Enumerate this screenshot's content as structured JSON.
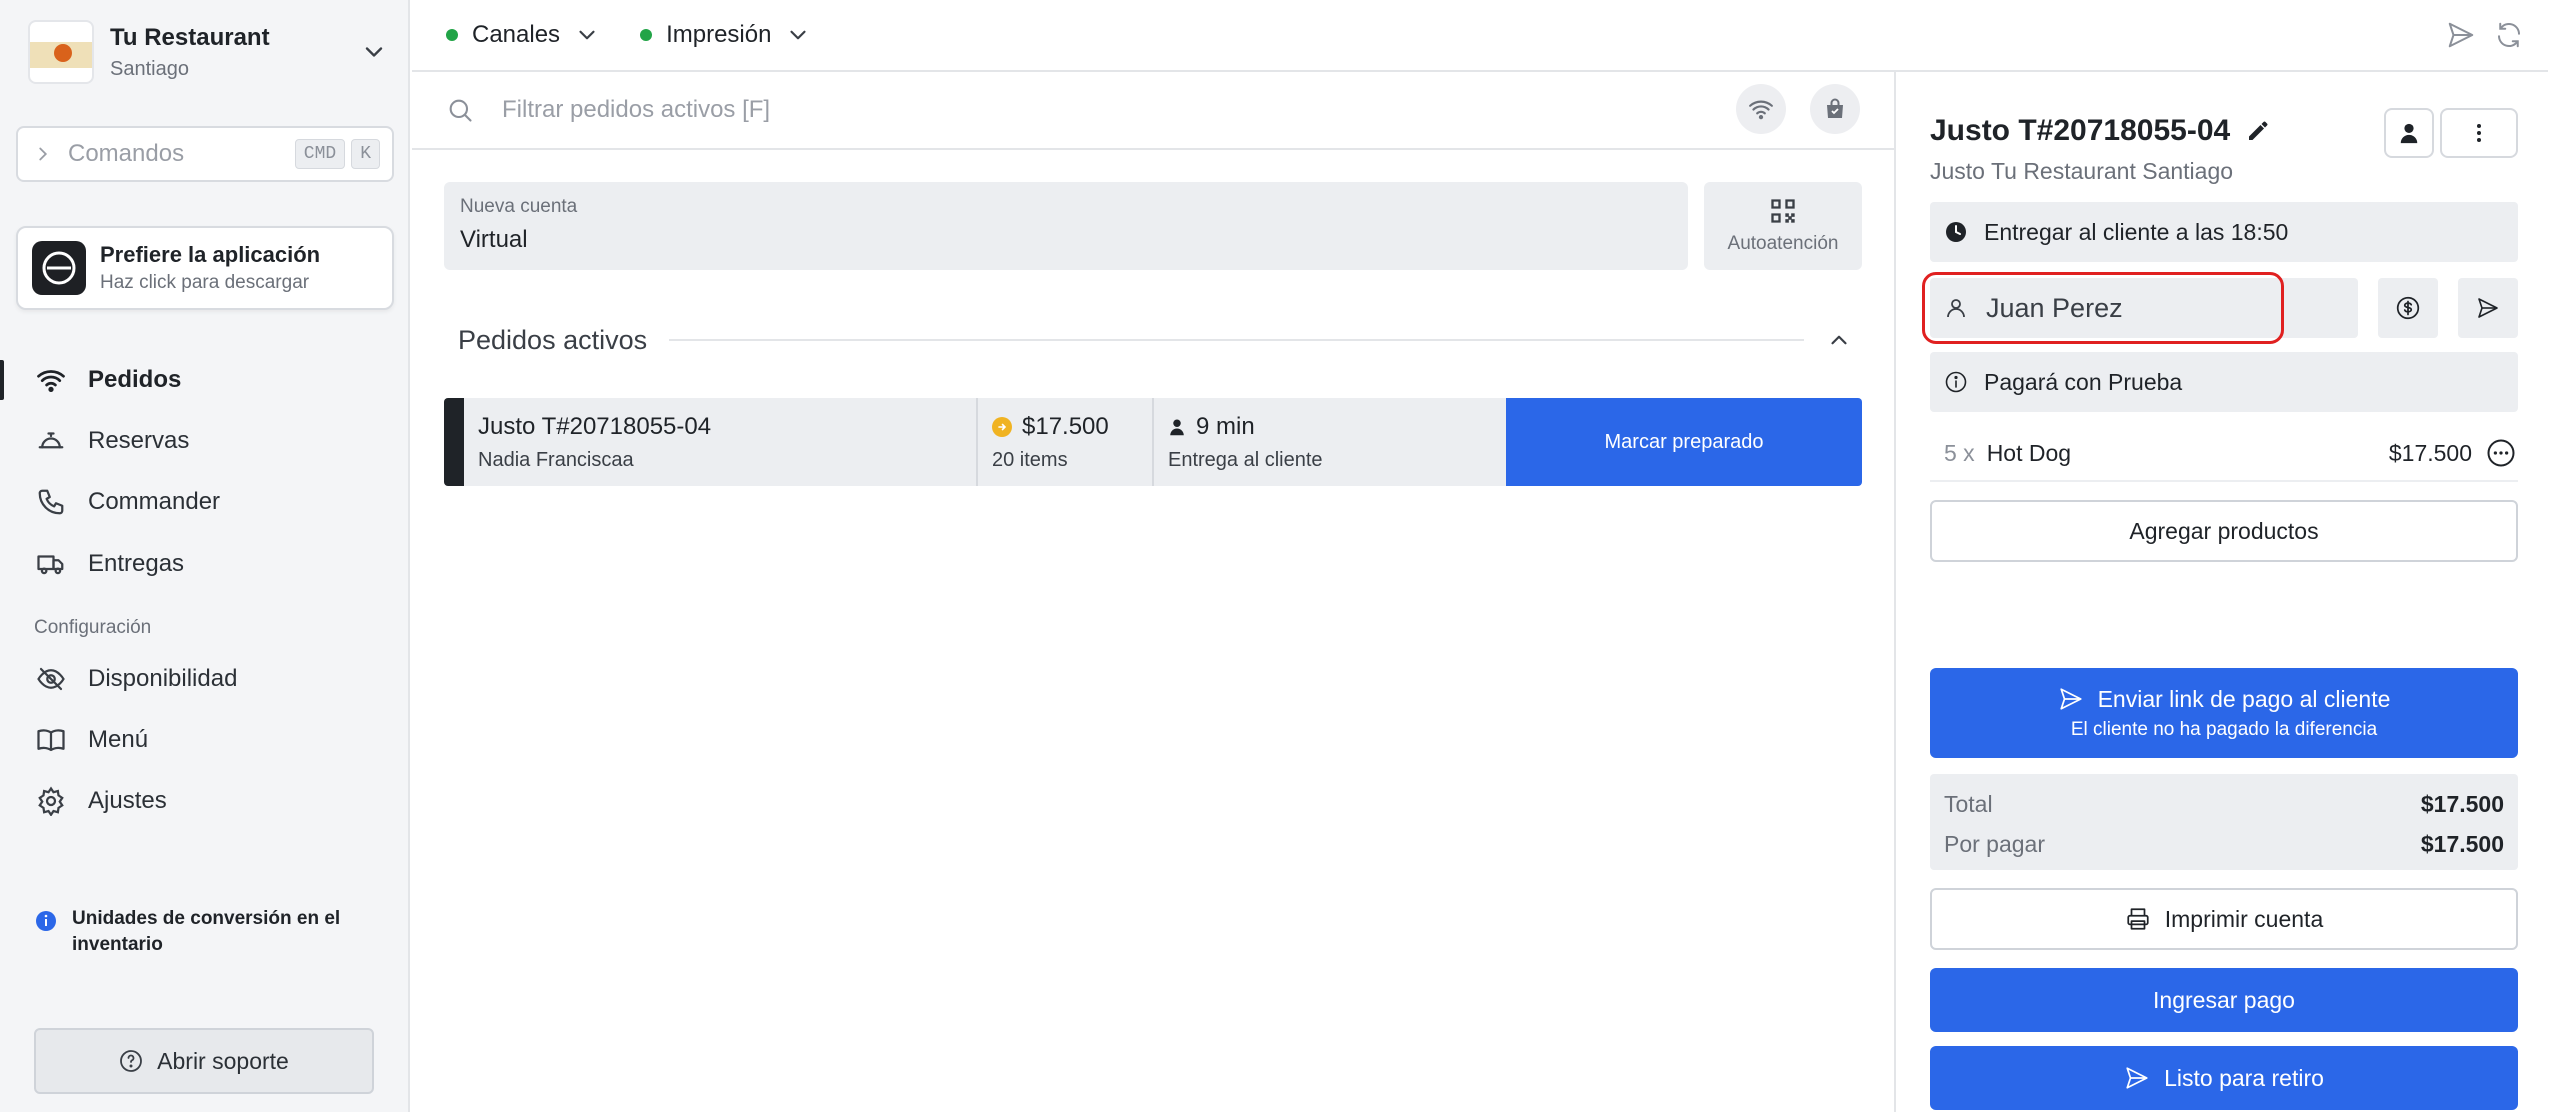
{
  "restaurant": {
    "name": "Tu Restaurant",
    "city": "Santiago"
  },
  "commands": {
    "label": "Comandos",
    "kbd1": "CMD",
    "kbd2": "K"
  },
  "app_promo": {
    "title": "Prefiere la aplicación",
    "subtitle": "Haz click para descargar"
  },
  "nav": {
    "items": [
      {
        "label": "Pedidos",
        "icon": "wifi-icon",
        "active": true
      },
      {
        "label": "Reservas",
        "icon": "bell-icon"
      },
      {
        "label": "Commander",
        "icon": "phone-icon"
      },
      {
        "label": "Entregas",
        "icon": "truck-icon"
      }
    ],
    "section_label": "Configuración",
    "config_items": [
      {
        "label": "Disponibilidad",
        "icon": "eye-off-icon"
      },
      {
        "label": "Menú",
        "icon": "book-icon"
      },
      {
        "label": "Ajustes",
        "icon": "gear-icon"
      }
    ]
  },
  "notice": {
    "text": "Unidades de conversión en el inventario"
  },
  "support": {
    "label": "Abrir soporte"
  },
  "topbar": {
    "channels_label": "Canales",
    "print_label": "Impresión",
    "status_color": "#22a447"
  },
  "filter": {
    "placeholder": "Filtrar pedidos activos [F]"
  },
  "new_account": {
    "caption": "Nueva cuenta",
    "value": "Virtual"
  },
  "self_service": {
    "label": "Autoatención"
  },
  "active_orders": {
    "title": "Pedidos activos",
    "orders": [
      {
        "code": "Justo T#20718055-04",
        "customer": "Nadia Franciscaa",
        "amount": "$17.500",
        "items": "20 items",
        "time": "9 min",
        "delivery": "Entrega al cliente",
        "action": "Marcar preparado"
      }
    ]
  },
  "order_detail": {
    "title": "Justo T#20718055-04",
    "subtitle": "Justo Tu Restaurant Santiago",
    "delivery_time": "Entregar al cliente a las 18:50",
    "customer_name": "Juan Perez",
    "payment_method": "Pagará con Prueba",
    "products": [
      {
        "qty": "5 x",
        "name": "Hot Dog",
        "price": "$17.500"
      }
    ],
    "add_products": "Agregar productos",
    "pay_link": {
      "title": "Enviar link de pago al cliente",
      "subtitle": "El cliente no ha pagado la diferencia"
    },
    "totals": [
      {
        "label": "Total",
        "value": "$17.500"
      },
      {
        "label": "Por pagar",
        "value": "$17.500"
      }
    ],
    "print_account": "Imprimir cuenta",
    "enter_payment": "Ingresar pago",
    "ready_pickup": "Listo para retiro"
  },
  "colors": {
    "accent": "#2b67e8",
    "highlight": "#e02020"
  }
}
